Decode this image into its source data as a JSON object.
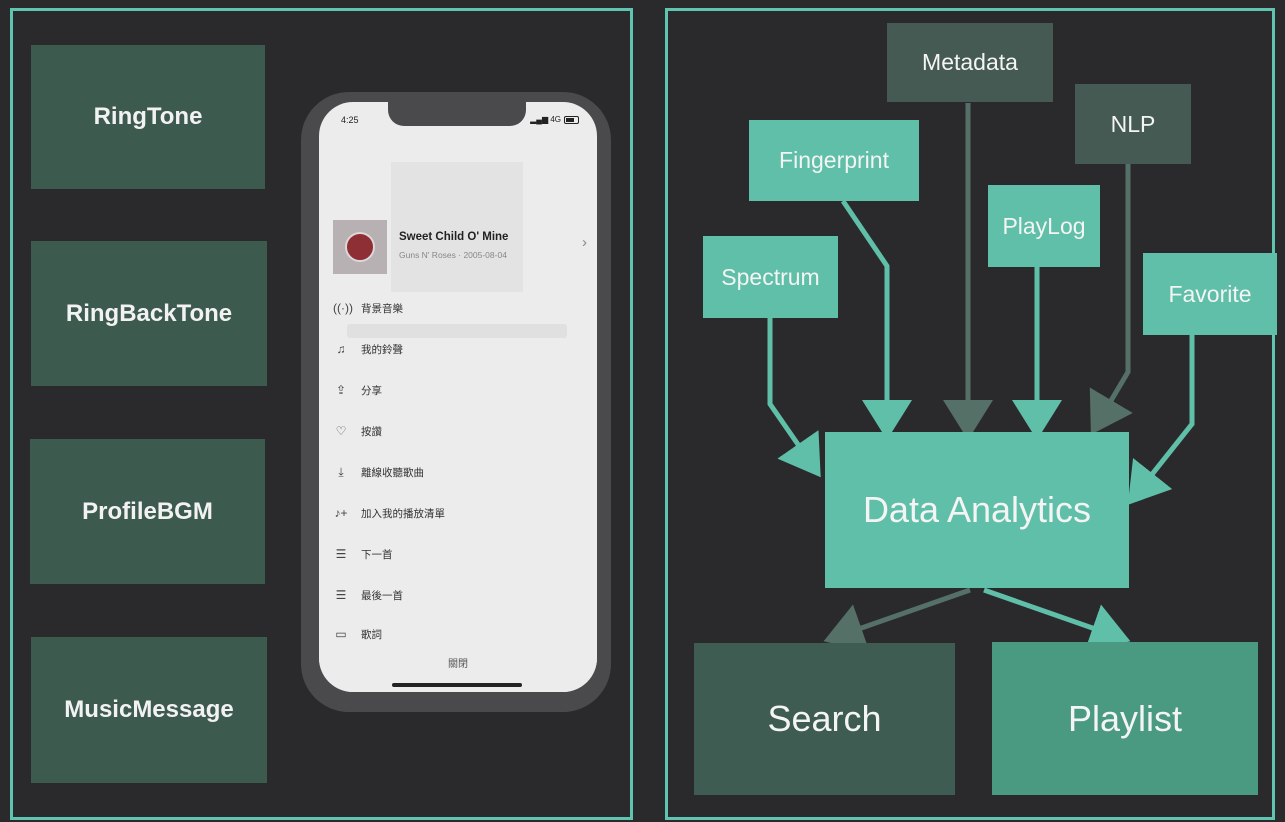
{
  "left_panel": {
    "features": [
      "RingTone",
      "RingBackTone",
      "ProfileBGM",
      "MusicMessage"
    ],
    "phone": {
      "status_time": "4:25",
      "status_signal": "4G",
      "song": {
        "title": "Sweet Child O' Mine",
        "subtitle": "Guns N' Roses · 2005-08-04"
      },
      "menu_items": [
        {
          "icon": "broadcast-icon",
          "glyph": "((·))",
          "label": "背景音樂"
        },
        {
          "icon": "music-note-icon",
          "glyph": "♫",
          "label": "我的鈴聲"
        },
        {
          "icon": "share-icon",
          "glyph": "⇪",
          "label": "分享"
        },
        {
          "icon": "heart-icon",
          "glyph": "♡",
          "label": "按讚"
        },
        {
          "icon": "download-icon",
          "glyph": "⤓",
          "label": "離線收聽歌曲"
        },
        {
          "icon": "add-to-playlist-icon",
          "glyph": "♪+",
          "label": "加入我的播放清單"
        },
        {
          "icon": "play-next-icon",
          "glyph": "☰",
          "label": "下一首"
        },
        {
          "icon": "play-last-icon",
          "glyph": "☰",
          "label": "最後一首"
        },
        {
          "icon": "lyrics-icon",
          "glyph": "▭",
          "label": "歌詞"
        }
      ],
      "close_label": "關閉"
    }
  },
  "right_panel": {
    "sources": {
      "metadata": "Metadata",
      "nlp": "NLP",
      "fingerprint": "Fingerprint",
      "playlog": "PlayLog",
      "spectrum": "Spectrum",
      "favorite": "Favorite"
    },
    "center": "Data Analytics",
    "outputs": {
      "search": "Search",
      "playlist": "Playlist"
    }
  },
  "colors": {
    "background": "#2a2a2c",
    "panel_border": "#5fc4b0",
    "teal_light": "#5fbfa8",
    "teal_dark": "#445a53",
    "feature_box": "#3d5a4f",
    "output_search": "#3e5c51",
    "output_playlist": "#4a9a82",
    "arrow_main": "#5fbfa8",
    "arrow_dark": "#557066"
  }
}
